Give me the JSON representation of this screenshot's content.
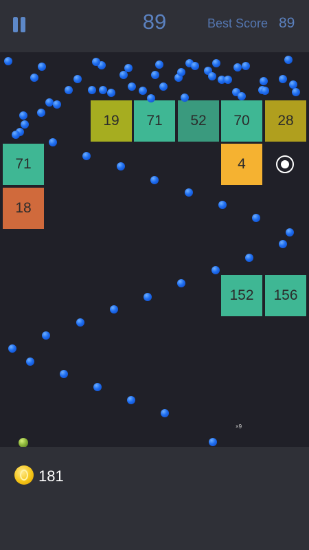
{
  "header": {
    "score": "89",
    "best_score_label": "Best Score",
    "best_score_value": "89"
  },
  "footer": {
    "coins": "181"
  },
  "board": {
    "multiplier": "×9",
    "bricks": [
      {
        "value": "19",
        "color": "#a6ad20"
      },
      {
        "value": "71",
        "color": "#3fb794"
      },
      {
        "value": "52",
        "color": "#3a9a7e"
      },
      {
        "value": "70",
        "color": "#3fb794"
      },
      {
        "value": "28",
        "color": "#b09f1e"
      },
      {
        "value": "71",
        "color": "#3fb794"
      },
      {
        "value": "4",
        "color": "#f5b231"
      },
      {
        "value": "18",
        "color": "#d06a3c"
      },
      {
        "value": "152",
        "color": "#3fb794"
      },
      {
        "value": "156",
        "color": "#3fb794"
      }
    ]
  },
  "icons": {
    "pause": "pause-icon",
    "coin": "coin-icon",
    "ring": "extra-ball-ring-icon"
  }
}
